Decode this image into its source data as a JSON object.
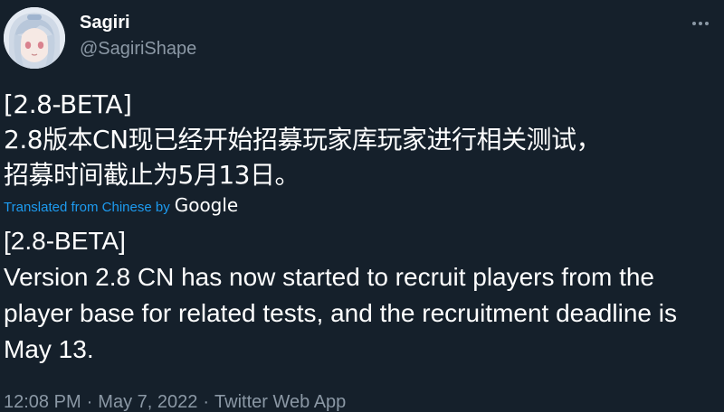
{
  "author": {
    "display_name": "Sagiri",
    "handle": "@SagiriShape"
  },
  "tweet": {
    "original_text": "[2.8-BETA]\n2.8版本CN现已经开始招募玩家库玩家进行相关测试，\n招募时间截止为5月13日。",
    "translated_from_label": "Translated from Chinese by",
    "translator_name": "Google",
    "translated_text": "[2.8-BETA]\n Version 2.8 CN has now started to recruit players from the player base for related tests, and the recruitment deadline is May 13."
  },
  "meta": {
    "time": "12:08 PM",
    "date": "May 7, 2022",
    "source": "Twitter Web App",
    "separator": "·"
  },
  "icons": {
    "more": "more-horizontal-icon"
  },
  "colors": {
    "background": "#15202b",
    "text": "#ffffff",
    "secondary": "#8b98a5",
    "link": "#1d9bf0"
  }
}
